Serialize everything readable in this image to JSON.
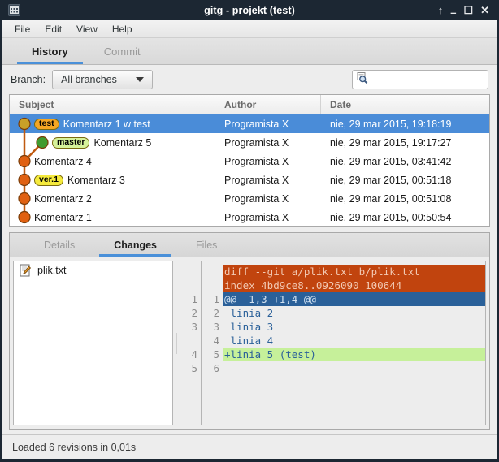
{
  "window": {
    "title": "gitg - projekt (test)",
    "icon": "app-grid-icon",
    "buttons": {
      "shade": "↑",
      "minimize": "–",
      "maximize": "☐",
      "close": "✕"
    }
  },
  "menubar": {
    "items": [
      {
        "label": "File"
      },
      {
        "label": "Edit"
      },
      {
        "label": "View"
      },
      {
        "label": "Help"
      }
    ]
  },
  "main_tabs": [
    {
      "label": "History",
      "active": true
    },
    {
      "label": "Commit",
      "active": false
    }
  ],
  "branch_bar": {
    "label": "Branch:",
    "selected": "All branches",
    "options": [
      "All branches"
    ],
    "search": {
      "value": "",
      "placeholder": "",
      "icon": "search-icon"
    }
  },
  "history": {
    "columns": [
      "Subject",
      "Author",
      "Date"
    ],
    "rows": [
      {
        "subject": "Komentarz 1 w test",
        "author": "Programista X",
        "date": "nie, 29 mar 2015, 19:18:19",
        "ref": "test",
        "ref_color": "#f5a623",
        "node_color": "#c8a028",
        "lane": 0,
        "selected": true
      },
      {
        "subject": "Komentarz 5",
        "author": "Programista X",
        "date": "nie, 29 mar 2015, 19:17:27",
        "ref": "master",
        "ref_color": "#d6f29a",
        "node_color": "#3f9b2f",
        "lane": 1,
        "selected": false
      },
      {
        "subject": "Komentarz 4",
        "author": "Programista X",
        "date": "nie, 29 mar 2015, 03:41:42",
        "ref": "",
        "ref_color": "",
        "node_color": "#e06010",
        "lane": 0,
        "selected": false
      },
      {
        "subject": "Komentarz 3",
        "author": "Programista X",
        "date": "nie, 29 mar 2015, 00:51:18",
        "ref": "ver.1",
        "ref_color": "#f5ea3c",
        "node_color": "#e06010",
        "lane": 0,
        "selected": false
      },
      {
        "subject": "Komentarz 2",
        "author": "Programista X",
        "date": "nie, 29 mar 2015, 00:51:08",
        "ref": "",
        "ref_color": "",
        "node_color": "#e06010",
        "lane": 0,
        "selected": false
      },
      {
        "subject": "Komentarz 1",
        "author": "Programista X",
        "date": "nie, 29 mar 2015, 00:50:54",
        "ref": "",
        "ref_color": "",
        "node_color": "#e06010",
        "lane": 0,
        "selected": false
      }
    ],
    "graph_line_color": "#c05a10"
  },
  "lower_tabs": [
    {
      "label": "Details",
      "active": false
    },
    {
      "label": "Changes",
      "active": true
    },
    {
      "label": "Files",
      "active": false
    }
  ],
  "file_list": [
    {
      "name": "plik.txt",
      "icon": "file-edit-icon"
    }
  ],
  "diff": {
    "lines": [
      {
        "old": "",
        "new": "",
        "text": "diff --git a/plik.txt b/plik.txt",
        "type": "header"
      },
      {
        "old": "",
        "new": "",
        "text": "index 4bd9ce8..0926090 100644",
        "type": "header"
      },
      {
        "old": "1",
        "new": "1",
        "text": "@@ -1,3 +1,4 @@",
        "type": "hunk"
      },
      {
        "old": "2",
        "new": "2",
        "text": " linia 2",
        "type": "context"
      },
      {
        "old": "3",
        "new": "3",
        "text": " linia 3",
        "type": "context"
      },
      {
        "old": "",
        "new": "4",
        "text": " linia 4",
        "type": "context"
      },
      {
        "old": "4",
        "new": "5",
        "text": "+linia 5 (test)",
        "type": "added"
      },
      {
        "old": "5",
        "new": "6",
        "text": "",
        "type": "blank"
      }
    ]
  },
  "statusbar": {
    "text": "Loaded 6 revisions in 0,01s"
  }
}
